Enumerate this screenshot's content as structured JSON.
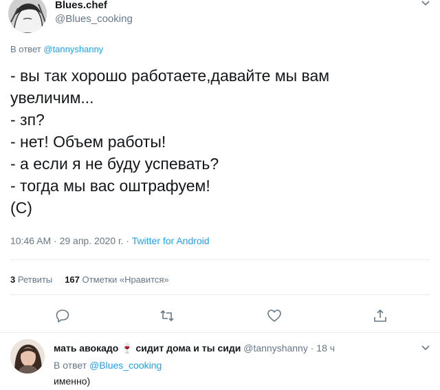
{
  "tweet": {
    "display_name": "Blues.chef",
    "handle": "@Blues_cooking",
    "reply_prefix": "В ответ",
    "reply_mention": "@tannyshanny",
    "text": "- вы так хорошо работаете,давайте мы вам\nувеличим...\n- зп?\n- нет! Объем работы!\n- а если я не буду успевать?\n- тогда мы вас оштрафуем!\n(С)",
    "time": "10:46 AM · 29 апр. 2020 г. ·",
    "source": "Twitter for Android"
  },
  "stats": {
    "retweets_count": "3",
    "retweets_label": "Ретвиты",
    "likes_count": "167",
    "likes_label": "Отметки «Нравится»"
  },
  "actions": [
    "reply-icon",
    "retweet-icon",
    "like-icon",
    "share-icon"
  ],
  "reply": {
    "display_name": "мать авокадо 🍷 сидит дома и ты сиди",
    "handle": "@tannyshanny · 18 ч",
    "reply_prefix": "В ответ",
    "reply_mention": "@Blues_cooking",
    "text": "именно)"
  },
  "colors": {
    "accent": "#1da1f2",
    "muted": "#657786",
    "text": "#14171a",
    "divider": "#e6ecf0"
  }
}
